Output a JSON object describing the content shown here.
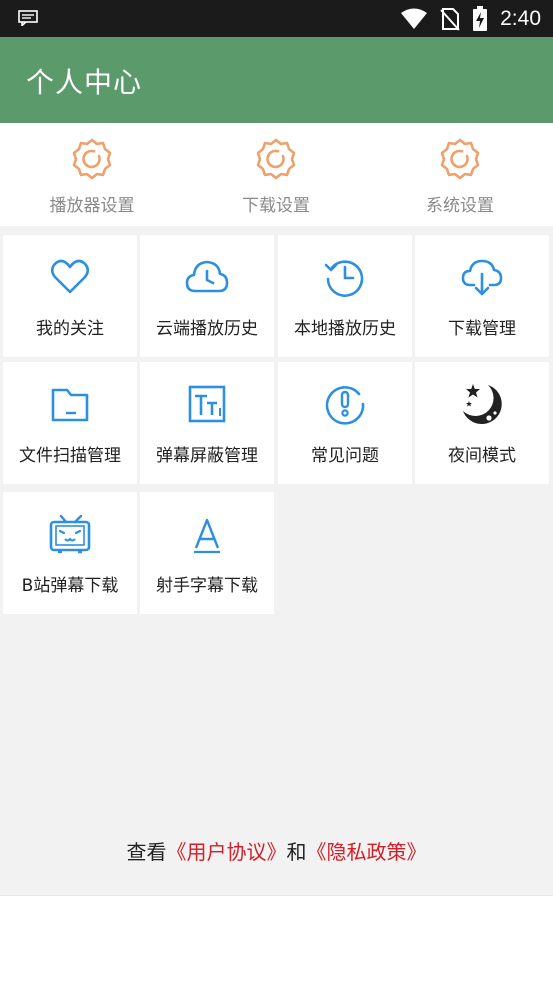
{
  "status_bar": {
    "time": "2:40"
  },
  "app_bar": {
    "title": "个人中心"
  },
  "settings": [
    {
      "label": "播放器设置",
      "icon": "gear-icon"
    },
    {
      "label": "下载设置",
      "icon": "gear-icon"
    },
    {
      "label": "系统设置",
      "icon": "gear-icon"
    }
  ],
  "grid": [
    {
      "label": "我的关注",
      "icon": "heart-icon"
    },
    {
      "label": "云端播放历史",
      "icon": "cloud-clock-icon"
    },
    {
      "label": "本地播放历史",
      "icon": "history-clock-icon"
    },
    {
      "label": "下载管理",
      "icon": "cloud-download-icon"
    },
    {
      "label": "文件扫描管理",
      "icon": "folder-icon"
    },
    {
      "label": "弹幕屏蔽管理",
      "icon": "text-size-icon"
    },
    {
      "label": "常见问题",
      "icon": "exclamation-icon"
    },
    {
      "label": "夜间模式",
      "icon": "moon-icon"
    },
    {
      "label": "B站弹幕下载",
      "icon": "tv-icon"
    },
    {
      "label": "射手字幕下载",
      "icon": "letter-a-icon"
    }
  ],
  "footer": {
    "prefix": "查看",
    "user_agreement": "《用户协议》",
    "conjunction": "和",
    "privacy_policy": "《隐私政策》"
  },
  "colors": {
    "app_bar": "#5b9b6b",
    "settings_icon": "#f0a06a",
    "grid_icon": "#2d8fe0",
    "link": "#d0202a"
  }
}
